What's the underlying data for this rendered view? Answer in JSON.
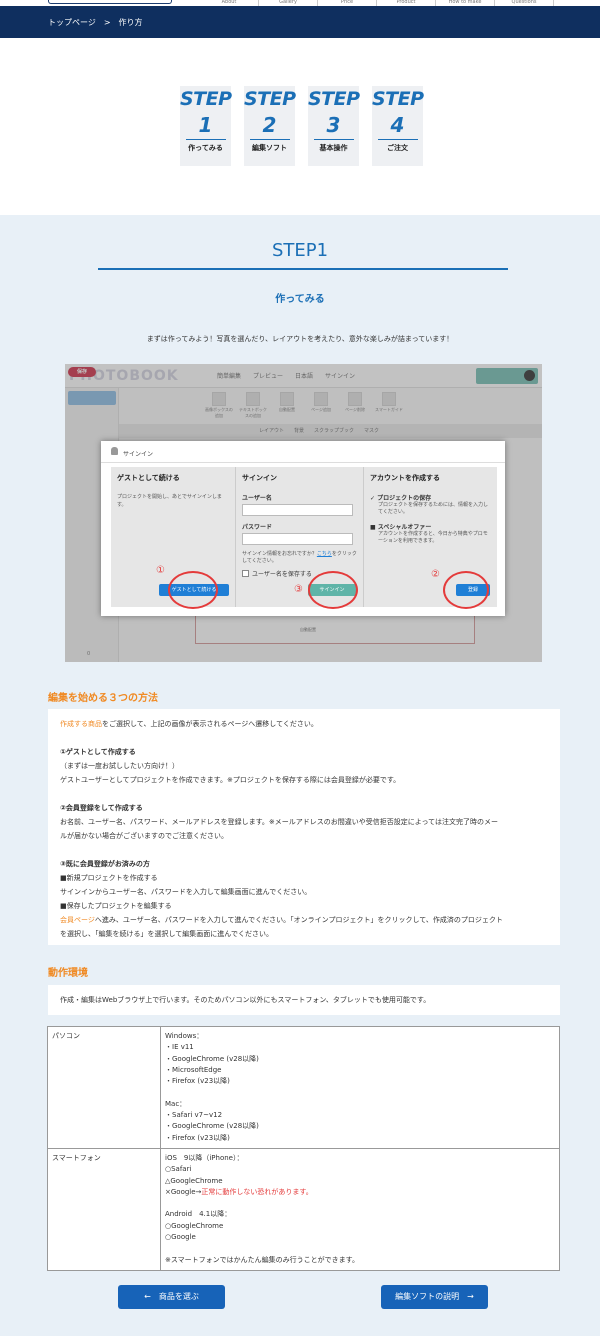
{
  "header": {
    "nav": [
      "About",
      "Gallery",
      "Price",
      "Product",
      "How to make",
      "Questions"
    ],
    "breadcrumb": [
      "トップページ",
      ">",
      "作り方"
    ]
  },
  "steps": [
    {
      "word": "STEP",
      "num": "1",
      "label": "作ってみる"
    },
    {
      "word": "STEP",
      "num": "2",
      "label": "編集ソフト"
    },
    {
      "word": "STEP",
      "num": "3",
      "label": "基本操作"
    },
    {
      "word": "STEP",
      "num": "4",
      "label": "ご注文"
    }
  ],
  "section": {
    "title": "STEP1",
    "subtitle": "作ってみる",
    "intro": "まずは作ってみよう！写真を選んだり、レイアウトを考えたり、意外な楽しみが詰まっています！"
  },
  "screenshot": {
    "save": "保存",
    "logo": "PHOTOBOOK",
    "menu": [
      "簡単編集",
      "プレビュー",
      "日本語",
      "サインイン"
    ],
    "tools": [
      "画像ボックスの追加",
      "テキストボックスの追加",
      "自動配置",
      "ページ追加",
      "ページ削除",
      "スマートガイド"
    ],
    "tabbar": [
      "レイアウト",
      "背景",
      "スクラップブック",
      "マスク"
    ],
    "canvas_label": "自動配置",
    "side_label": "0",
    "dialog": {
      "title": "サインイン",
      "guest": {
        "heading": "ゲストとして続ける",
        "desc": "プロジェクトを開始し、あとでサインインします。",
        "button": "ゲストとして続ける"
      },
      "signin": {
        "heading": "サインイン",
        "user_label": "ユーザー名",
        "pass_label": "パスワード",
        "forgot": "サインイン情報をお忘れですか？",
        "forgot_link": "こちら",
        "forgot_tail": "をクリックしてください。",
        "remember": "ユーザー名を保存する",
        "button": "サインイン"
      },
      "create": {
        "heading": "アカウントを作成する",
        "b1_title": "プロジェクトの保存",
        "b1_desc": "プロジェクトを保存するためには、情報を入力してください。",
        "b2_title": "スペシャルオファー",
        "b2_desc": "アカウントを作成すると、今日から特典やプロモーションを利用できます。",
        "button": "登録"
      },
      "marks": [
        "①",
        "②",
        "③"
      ]
    }
  },
  "three_ways": {
    "title": "編集を始める３つの方法",
    "lead_link": "作成する商品",
    "lead_rest": "をご選択して、上記の画像が表示されるページへ遷移してください。",
    "m1_title": "①ゲストとして作成する",
    "m1_line1": "（まずは一度お試ししたい方向け！）",
    "m1_line2": "ゲストユーザーとしてプロジェクトを作成できます。※プロジェクトを保存する際には会員登録が必要です。",
    "m2_title": "②会員登録をして作成する",
    "m2_line1": "お名前、ユーザー名、パスワード、メールアドレスを登録します。※メールアドレスのお間違いや受信拒否設定によっては注文完了時のメー",
    "m2_line2": "ルが届かない場合がございますのでご注意ください。",
    "m3_title": "③既に会員登録がお済みの方",
    "m3_line1": "■新規プロジェクトを作成する",
    "m3_line2": "サインインからユーザー名、パスワードを入力して編集画面に進んでください。",
    "m3_line3": "■保存したプロジェクトを編集する",
    "m3_link": "会員ページ",
    "m3_line4": "へ進み、ユーザー名、パスワードを入力して進んでください。「オンラインプロジェクト」をクリックして、作成済のプロジェクト",
    "m3_line5": "を選択し、「編集を続ける」を選択して編集画面に進んでください。"
  },
  "env": {
    "title": "動作環境",
    "note": "作成・編集はWebブラウザ上で行います。そのためパソコン以外にもスマートフォン、タブレットでも使用可能です。",
    "pc_label": "パソコン",
    "pc_lines": [
      "Windows：",
      "・IE v11",
      "・GoogleChrome (v28以降)",
      "・MicrosoftEdge",
      "・Firefox (v23以降)",
      "",
      "Mac：",
      "・Safari v7~v12",
      "・GoogleChrome (v28以降)",
      "・Firefox (v23以降)"
    ],
    "sp_label": "スマートフォン",
    "sp_lines": [
      "iOS　9以降（iPhone）：",
      "○Safari",
      "△GoogleChrome",
      "×Google→",
      "",
      "Android　4.1以降：",
      "○GoogleChrome",
      "○Google",
      "",
      "※スマートフォンではかんたん編集のみ行うことができます。"
    ],
    "sp_warning": "正常に動作しない恐れがあります。"
  },
  "buttons": {
    "prev": "←　商品を選ぶ",
    "next": "編集ソフトの説明　→"
  }
}
